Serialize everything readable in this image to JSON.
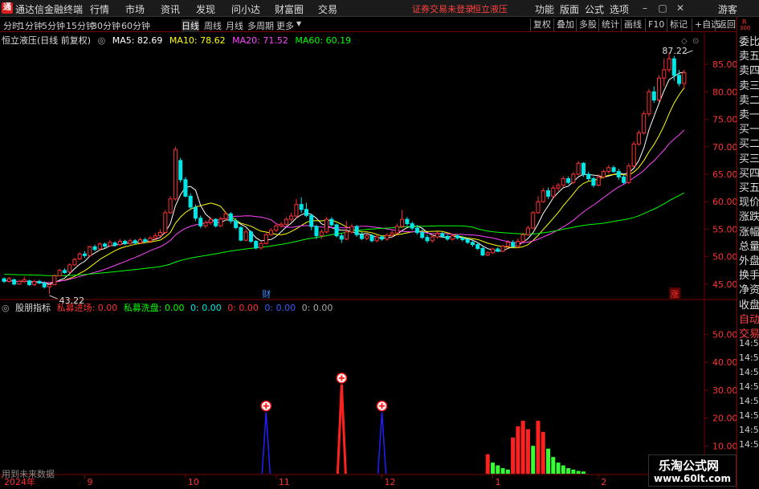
{
  "app": {
    "logo": "通",
    "title": "通达信金融终端"
  },
  "menu": {
    "items": [
      "行情",
      "市场",
      "资讯",
      "发现",
      "问小达",
      "财富圈",
      "交易"
    ],
    "status_red": [
      "证券交易未登录",
      "恒立液压"
    ],
    "right_items": [
      "功能",
      "版面",
      "公式",
      "选项"
    ],
    "user": "游客"
  },
  "periods": {
    "items": [
      "分时",
      "1分钟",
      "5分钟",
      "15分钟",
      "30分钟",
      "60分钟",
      "日线",
      "周线",
      "月线",
      "多周期",
      "更多"
    ],
    "active": "日线"
  },
  "toolbar": {
    "items": [
      "复权",
      "叠加",
      "多股",
      "统计",
      "画线",
      "F10",
      "标记",
      "+自选",
      "返回"
    ]
  },
  "main_legend": {
    "stock": "恒立液压(日线 前复权)",
    "ma5": "MA5: 82.69",
    "ma10": "MA10: 78.62",
    "ma20": "MA20: 71.52",
    "ma60": "MA60: 60.19"
  },
  "indicator_legend": {
    "name": "股朋指标",
    "smart_in": "私募进场: 0.00",
    "smart_wash": "私募洗盘: 0.00",
    "v1": "0: 0.00",
    "v2": "0: 0.00",
    "v3": "0: 0.00",
    "v4": "0: 0.00"
  },
  "right_panel": {
    "labels": [
      "委比",
      "卖五",
      "卖四",
      "卖三",
      "卖二",
      "卖一",
      "买一",
      "买二",
      "买三",
      "买四",
      "买五",
      "现价",
      "涨跌",
      "涨幅",
      "总量",
      "外盘",
      "换手",
      "净资",
      "收盘",
      "自动",
      "交易"
    ],
    "times": [
      "14:5",
      "14:5",
      "14:5",
      "14:5",
      "14:5",
      "14:5",
      "14:5",
      "14:5"
    ],
    "top_tag": "R",
    "top_num": "300"
  },
  "bottom_note": "用到未来数据",
  "watermark": {
    "line1": "乐淘公式网",
    "line2": "www.60lt.com"
  },
  "colors": {
    "up": "#ff3232",
    "down": "#00e6e6",
    "ma5": "#ffffff",
    "ma10": "#ffff00",
    "ma20": "#ff44ff",
    "ma60": "#00ff00",
    "bg": "#000000",
    "axis": "#7a0000"
  },
  "chart_data": [
    {
      "type": "candlestick",
      "title": "恒立液压(日线 前复权)",
      "yticks": [
        45,
        50,
        55,
        60,
        65,
        70,
        75,
        80,
        85
      ],
      "ylim": [
        42.5,
        87.5
      ],
      "annotations": [
        {
          "label": "43.22",
          "x_index": 9,
          "value": 43.22
        },
        {
          "label": "87.22",
          "x_index": 137,
          "value": 87.22
        },
        {
          "label": "财",
          "x_index": 52
        },
        {
          "label": "涨",
          "x_index": 133
        }
      ],
      "candles": [
        [
          46,
          45.5,
          45.2,
          46.2
        ],
        [
          45.5,
          46,
          45.3,
          46.3
        ],
        [
          45.8,
          45,
          44.8,
          46
        ],
        [
          45,
          45.5,
          44.9,
          45.8
        ],
        [
          45.5,
          45.8,
          45.2,
          46.4
        ],
        [
          45.6,
          44.9,
          44.7,
          45.8
        ],
        [
          44.9,
          45.5,
          44.7,
          45.8
        ],
        [
          45.5,
          45.2,
          45.0,
          45.8
        ],
        [
          45.2,
          44.5,
          44.2,
          45.5
        ],
        [
          44.5,
          44.9,
          43.22,
          45
        ],
        [
          44.9,
          46.5,
          44.8,
          46.8
        ],
        [
          46.5,
          47.5,
          46.4,
          47.8
        ],
        [
          47.5,
          47.1,
          46.9,
          47.9
        ],
        [
          47.2,
          48.5,
          47,
          48.8
        ],
        [
          48.5,
          49.5,
          48.3,
          49.8
        ],
        [
          49.6,
          50.5,
          49.4,
          50.8
        ],
        [
          50.5,
          50.2,
          49.8,
          51
        ],
        [
          50.2,
          51.8,
          50,
          52
        ],
        [
          51.8,
          51.3,
          51,
          52.2
        ],
        [
          51.4,
          52.3,
          51.2,
          52.6
        ],
        [
          52.3,
          51.9,
          51.6,
          52.6
        ],
        [
          52,
          52.6,
          51.8,
          53
        ],
        [
          52.5,
          52.1,
          51.8,
          52.8
        ],
        [
          52.2,
          52.8,
          52,
          53.2
        ],
        [
          52.8,
          52.4,
          52.1,
          53.1
        ],
        [
          52.4,
          52.9,
          52.2,
          53.3
        ],
        [
          52.9,
          52.5,
          52.2,
          53.2
        ],
        [
          52.5,
          53.1,
          52.3,
          53.5
        ],
        [
          53.1,
          52.8,
          52.5,
          53.5
        ],
        [
          52.8,
          53.4,
          52.5,
          53.8
        ],
        [
          53.4,
          53.8,
          53,
          54.3
        ],
        [
          53.8,
          54.4,
          53.5,
          55
        ],
        [
          54.4,
          58,
          54.2,
          58.5
        ],
        [
          58,
          60.5,
          57.8,
          61
        ],
        [
          60.5,
          69.5,
          60.2,
          70
        ],
        [
          67.5,
          64,
          63.5,
          68
        ],
        [
          64,
          61,
          60.8,
          64.5
        ],
        [
          61,
          59,
          58.5,
          61.5
        ],
        [
          59,
          57,
          56.5,
          59.5
        ],
        [
          57,
          55.6,
          55.2,
          57.5
        ],
        [
          55.6,
          56.2,
          55.2,
          56.6
        ],
        [
          56.2,
          56.8,
          55.8,
          57.2
        ],
        [
          56.8,
          55.6,
          55.3,
          57
        ],
        [
          55.6,
          56.9,
          55.4,
          57.3
        ],
        [
          56.9,
          57.8,
          56.6,
          58.2
        ],
        [
          57.8,
          56.5,
          56,
          58.1
        ],
        [
          56.5,
          55.3,
          55,
          57
        ],
        [
          55.3,
          53,
          52.8,
          55.6
        ],
        [
          53,
          54.5,
          52.8,
          55
        ],
        [
          54.5,
          52.8,
          52.5,
          54.8
        ],
        [
          52.8,
          51.6,
          51.3,
          53
        ],
        [
          51.6,
          52.4,
          51.3,
          52.7
        ],
        [
          52.4,
          54,
          52.2,
          54.3
        ],
        [
          54,
          54.8,
          53.8,
          55.2
        ],
        [
          54.8,
          55.6,
          54.5,
          56
        ],
        [
          55.6,
          55.9,
          55.2,
          56.3
        ],
        [
          55.9,
          56.8,
          55.5,
          57.2
        ],
        [
          56.8,
          57.4,
          56.4,
          58
        ],
        [
          57.4,
          59.5,
          57,
          60.5
        ],
        [
          59.5,
          58.6,
          58,
          60.8
        ],
        [
          58.6,
          57.5,
          57.2,
          59.8
        ],
        [
          57.5,
          55.5,
          54.8,
          57.8
        ],
        [
          55.5,
          53.8,
          53.2,
          55.8
        ],
        [
          53.8,
          54.5,
          53.2,
          55
        ],
        [
          54.5,
          56.8,
          54.2,
          57.2
        ],
        [
          56.8,
          55.8,
          55.5,
          57.2
        ],
        [
          55.8,
          53.8,
          53.5,
          56
        ],
        [
          53.8,
          53.2,
          52.5,
          54.2
        ],
        [
          53.2,
          54.5,
          53,
          56.5
        ],
        [
          54.5,
          55.5,
          54.2,
          56
        ],
        [
          55.5,
          54,
          53.6,
          55.8
        ],
        [
          54,
          53.3,
          53,
          54.5
        ],
        [
          53.3,
          53.8,
          53,
          54.2
        ],
        [
          53.8,
          52.9,
          52.6,
          54.1
        ],
        [
          52.9,
          53.6,
          52.6,
          54
        ],
        [
          53.6,
          53.2,
          52.9,
          53.9
        ],
        [
          53.2,
          53.9,
          52.9,
          54.3
        ],
        [
          53.9,
          54.3,
          53.5,
          54.8
        ],
        [
          54.3,
          55.5,
          54,
          56
        ],
        [
          55.5,
          56.8,
          55.2,
          58.5
        ],
        [
          56.8,
          56,
          55.6,
          57.2
        ],
        [
          56,
          55.2,
          54.8,
          56.4
        ],
        [
          55.2,
          54.4,
          54,
          55.8
        ],
        [
          54.4,
          53.5,
          53.2,
          55
        ],
        [
          53.5,
          52.9,
          52.5,
          54
        ],
        [
          52.9,
          53.6,
          52.6,
          54
        ],
        [
          53.6,
          54.2,
          53.3,
          54.6
        ],
        [
          54.2,
          53.7,
          53.4,
          54.5
        ],
        [
          53.7,
          53.2,
          52.9,
          54
        ],
        [
          53.2,
          53.8,
          52.9,
          54.2
        ],
        [
          53.8,
          53.4,
          53.1,
          54.1
        ],
        [
          53.4,
          53.1,
          52.8,
          53.8
        ],
        [
          53.1,
          52.6,
          52.3,
          53.4
        ],
        [
          52.6,
          52.2,
          51.8,
          53
        ],
        [
          52.2,
          51.5,
          51.2,
          52.6
        ],
        [
          51.5,
          50.3,
          50.1,
          51.8
        ],
        [
          50.3,
          50.7,
          50.1,
          51
        ],
        [
          50.7,
          51.4,
          50.5,
          51.6
        ],
        [
          51.4,
          51,
          50.8,
          51.7
        ],
        [
          51,
          51.9,
          50.8,
          52.2
        ],
        [
          51.9,
          52.6,
          51.6,
          53
        ],
        [
          52.6,
          51.9,
          51.6,
          53
        ],
        [
          51.9,
          52.8,
          51.6,
          53.3
        ],
        [
          52.8,
          54,
          52.6,
          54.3
        ],
        [
          54,
          55.2,
          53.8,
          55.6
        ],
        [
          55.2,
          58,
          55,
          58.3
        ],
        [
          58,
          60,
          57.8,
          61
        ],
        [
          60,
          62,
          59.8,
          62.5
        ],
        [
          62,
          61,
          60.5,
          62.6
        ],
        [
          61,
          62.5,
          60.7,
          63
        ],
        [
          62.5,
          63,
          62,
          63.4
        ],
        [
          63,
          64.2,
          62.6,
          64.6
        ],
        [
          64.2,
          63.5,
          63.2,
          64.6
        ],
        [
          63.5,
          65,
          63.2,
          65.4
        ],
        [
          65,
          67,
          64.8,
          67.4
        ],
        [
          67,
          65,
          64.5,
          67.2
        ],
        [
          65,
          64.2,
          63.8,
          65.5
        ],
        [
          64.2,
          63,
          62.6,
          64.6
        ],
        [
          63,
          64.5,
          62.8,
          65
        ],
        [
          64.5,
          65.5,
          64.2,
          65.8
        ],
        [
          65.5,
          66.2,
          65.1,
          66.6
        ],
        [
          66.2,
          65.5,
          65.2,
          66.6
        ],
        [
          65.5,
          64.5,
          64,
          66
        ],
        [
          64.5,
          63.5,
          63.2,
          65
        ],
        [
          63.5,
          66.5,
          63.2,
          67
        ],
        [
          66.5,
          70.5,
          66.2,
          71
        ],
        [
          70.5,
          72.5,
          70.2,
          73
        ],
        [
          72.5,
          76,
          72.2,
          76.5
        ],
        [
          76,
          80,
          75.5,
          80.5
        ],
        [
          80,
          78.5,
          78,
          81
        ],
        [
          78.5,
          82.5,
          78.2,
          83
        ],
        [
          82.5,
          84,
          81,
          86
        ],
        [
          84,
          86,
          83.5,
          87.22
        ],
        [
          86,
          83,
          82,
          86.5
        ],
        [
          83,
          81.5,
          81,
          84
        ],
        [
          81.5,
          83.5,
          80.5,
          84
        ]
      ],
      "ma_series": [
        {
          "name": "MA5",
          "color": "#ffffff"
        },
        {
          "name": "MA10",
          "color": "#ffff00"
        },
        {
          "name": "MA20",
          "color": "#ff44ff"
        },
        {
          "name": "MA60",
          "color": "#00ff00"
        }
      ]
    },
    {
      "type": "bar",
      "title": "股朋指标",
      "yticks": [
        10,
        20,
        30,
        40,
        50
      ],
      "ylim": [
        0,
        55
      ],
      "signals": [
        {
          "x_index": 52,
          "value": 22,
          "color": "blue"
        },
        {
          "x_index": 67,
          "value": 32,
          "color": "red"
        },
        {
          "x_index": 75,
          "value": 22,
          "color": "blue"
        }
      ],
      "red_bars": [
        {
          "x_index": 96,
          "value": 7
        },
        {
          "x_index": 101,
          "value": 13
        },
        {
          "x_index": 102,
          "value": 17
        },
        {
          "x_index": 103,
          "value": 19
        },
        {
          "x_index": 104,
          "value": 16
        },
        {
          "x_index": 106,
          "value": 19
        },
        {
          "x_index": 107,
          "value": 15
        }
      ],
      "green_bars": [
        {
          "x_index": 97,
          "value": 4
        },
        {
          "x_index": 98,
          "value": 3
        },
        {
          "x_index": 99,
          "value": 2
        },
        {
          "x_index": 100,
          "value": 1.5
        },
        {
          "x_index": 105,
          "value": 10
        },
        {
          "x_index": 108,
          "value": 9
        },
        {
          "x_index": 109,
          "value": 6
        },
        {
          "x_index": 110,
          "value": 4
        },
        {
          "x_index": 111,
          "value": 3
        },
        {
          "x_index": 112,
          "value": 2
        },
        {
          "x_index": 113,
          "value": 1.5
        },
        {
          "x_index": 114,
          "value": 1
        },
        {
          "x_index": 115,
          "value": 0.8
        }
      ]
    }
  ],
  "x_axis": {
    "labels": [
      {
        "text": "2024年",
        "x_index": 0
      },
      {
        "text": "9",
        "x_index": 16
      },
      {
        "text": "10",
        "x_index": 36
      },
      {
        "text": "11",
        "x_index": 54
      },
      {
        "text": "12",
        "x_index": 75
      },
      {
        "text": "1",
        "x_index": 97
      },
      {
        "text": "2",
        "x_index": 118
      }
    ]
  }
}
